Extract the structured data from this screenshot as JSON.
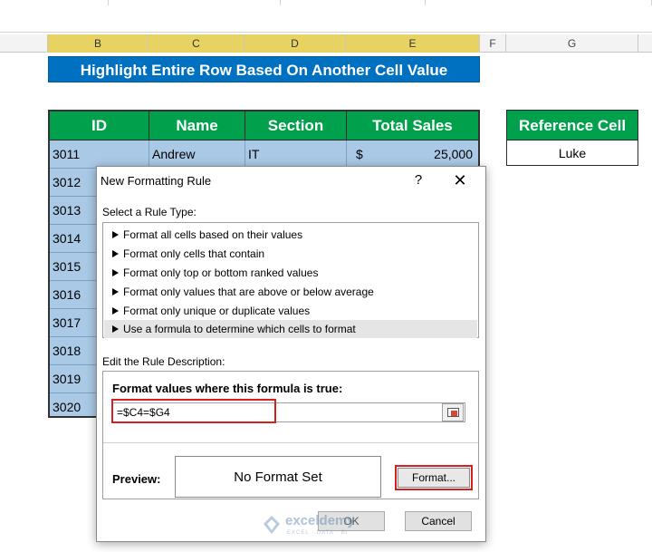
{
  "columns": [
    "B",
    "C",
    "D",
    "E",
    "F",
    "G"
  ],
  "banner": "Highlight Entire Row Based On Another Cell Value",
  "table": {
    "headers": [
      "ID",
      "Name",
      "Section",
      "Total Sales"
    ],
    "first_row": {
      "id": "3011",
      "name": "Andrew",
      "section": "IT",
      "currency": "$",
      "sales": "25,000"
    },
    "ids": [
      "3012",
      "3013",
      "3014",
      "3015",
      "3016",
      "3017",
      "3018",
      "3019",
      "3020"
    ]
  },
  "reference": {
    "header": "Reference Cell",
    "value": "Luke"
  },
  "dialog": {
    "title": "New Formatting Rule",
    "help": "?",
    "close": "✕",
    "select_label": "Select a Rule Type:",
    "rule_types": [
      "Format all cells based on their values",
      "Format only cells that contain",
      "Format only top or bottom ranked values",
      "Format only values that are above or below average",
      "Format only unique or duplicate values",
      "Use a formula to determine which cells to format"
    ],
    "selected_rule_index": 5,
    "edit_label": "Edit the Rule Description:",
    "formula_label": "Format values where this formula is true:",
    "formula_value": "=$C4=$G4",
    "preview_label": "Preview:",
    "preview_text": "No Format Set",
    "format_button": "Format...",
    "ok_button": "OK",
    "cancel_button": "Cancel"
  },
  "watermark": {
    "name": "exceldemy",
    "tagline": "EXCEL · DATA · BI"
  },
  "colors": {
    "header_green": "#00a04d",
    "banner_blue": "#0070c0",
    "highlight_red": "#d62020",
    "row_blue": "#a9c9e7"
  },
  "icons": [
    "triangle-right-icon",
    "close-icon",
    "help-icon",
    "collapse-dialog-icon"
  ]
}
